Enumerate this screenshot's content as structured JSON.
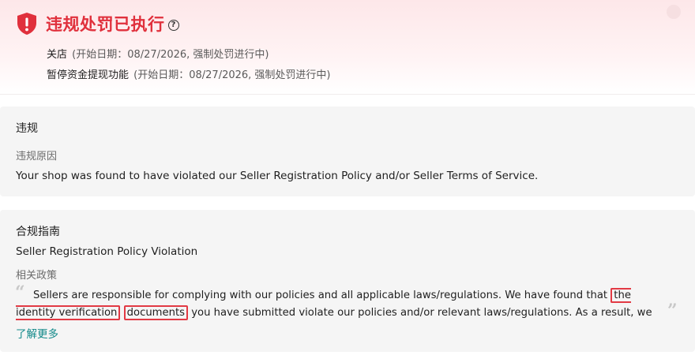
{
  "banner": {
    "title": "违规处罚已执行",
    "help_icon": "question-circle-icon",
    "penalties": [
      {
        "name": "关店",
        "meta": "(开始日期：08/27/2026, 强制处罚进行中)"
      },
      {
        "name": "暂停资金提现功能",
        "meta": "(开始日期：08/27/2026, 强制处罚进行中)"
      }
    ],
    "accent_color": "#e0303c"
  },
  "violation": {
    "heading": "违规",
    "reason_label": "违规原因",
    "reason_text": "Your shop was found to have violated our Seller Registration Policy and/or Seller Terms of Service."
  },
  "guidance": {
    "heading": "合规指南",
    "policy_title": "Seller Registration Policy Violation",
    "related_label": "相关政策",
    "quote_before": "Sellers are responsible for complying with our policies and all applicable laws/regulations. We have found that ",
    "quote_highlight_1": "the identity verification",
    "quote_highlight_2": "documents",
    "quote_after": " you have submitted violate our policies and/or relevant laws/regulations. As a result, we have deactivated your shop. If…",
    "learn_more": "了解更多",
    "link_color": "#138a8a"
  }
}
